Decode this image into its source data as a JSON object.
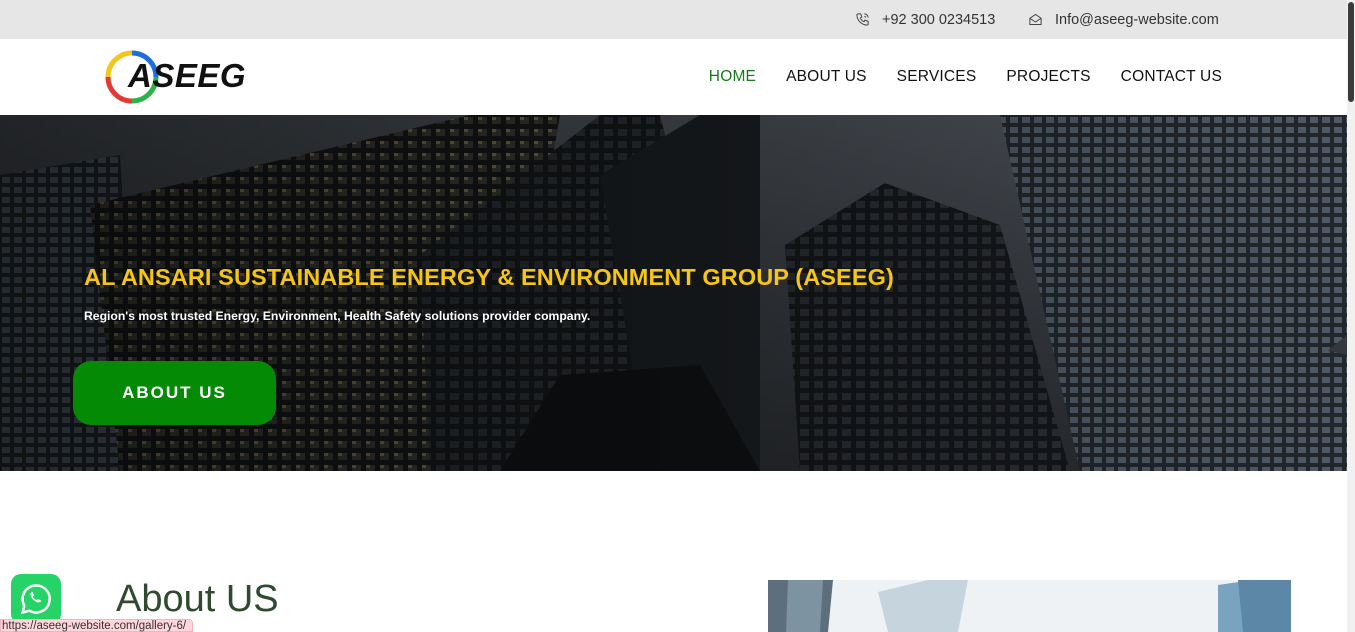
{
  "topbar": {
    "phone": "+92 300 0234513",
    "phone_icon": "phone-icon",
    "email": "Info@aseeg-website.com",
    "email_icon": "mail-icon",
    "background": "#e6e6e6"
  },
  "header": {
    "logo_text": "ASEEG",
    "nav": [
      {
        "label": "HOME",
        "active": true
      },
      {
        "label": "ABOUT US",
        "active": false
      },
      {
        "label": "SERVICES",
        "active": false
      },
      {
        "label": "PROJECTS",
        "active": false
      },
      {
        "label": "CONTACT US",
        "active": false
      }
    ],
    "active_color": "#1a7a1a"
  },
  "hero": {
    "title": "AL ANSARI SUSTAINABLE ENERGY & ENVIRONMENT GROUP (ASEEG)",
    "subtitle": "Region's most trusted Energy, Environment, Health Safety solutions provider company.",
    "button_label": "ABOUT US",
    "title_color": "#f5c518",
    "button_color": "#058a05"
  },
  "about": {
    "heading": "About US"
  },
  "floating": {
    "whatsapp_icon": "whatsapp-icon"
  },
  "statusbar": {
    "url": "https://aseeg-website.com/gallery-6/"
  }
}
